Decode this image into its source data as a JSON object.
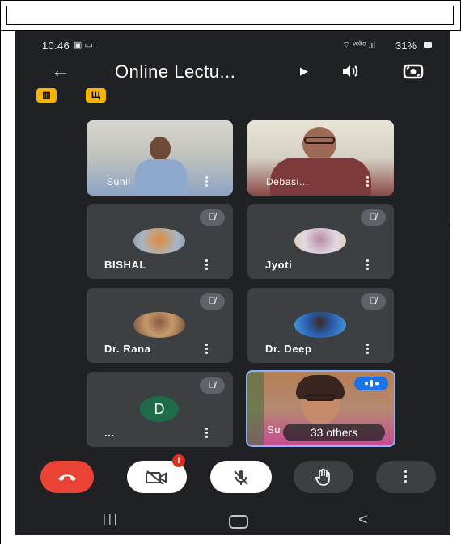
{
  "status": {
    "time": "10:46",
    "battery": "31%"
  },
  "header": {
    "back_icon": "arrow-left-icon",
    "title": "Online Lectu...",
    "speaker_icon": "speaker-icon",
    "switch_camera_icon": "switch-camera-icon"
  },
  "participants": [
    {
      "name": "Sunil"
    },
    {
      "name": "Debasi..."
    },
    {
      "name": "BISHAL"
    },
    {
      "name": "Jyoti"
    },
    {
      "name": "Dr. Rana"
    },
    {
      "name": "Dr. Deep"
    },
    {
      "name": "...",
      "initial": "D"
    },
    {
      "name": "Su",
      "others": "33 others"
    }
  ],
  "controls": {
    "end_call": "end-call-icon",
    "camera_off_badge": "!",
    "mic_off": "mic-off-icon",
    "raise_hand": "raise-hand-icon",
    "more": "more-vert-icon"
  },
  "colors": {
    "background": "#202124",
    "tile": "#3c4043",
    "end_call": "#ea4335",
    "chip": "#f4b400",
    "accent": "#1a73e8"
  }
}
